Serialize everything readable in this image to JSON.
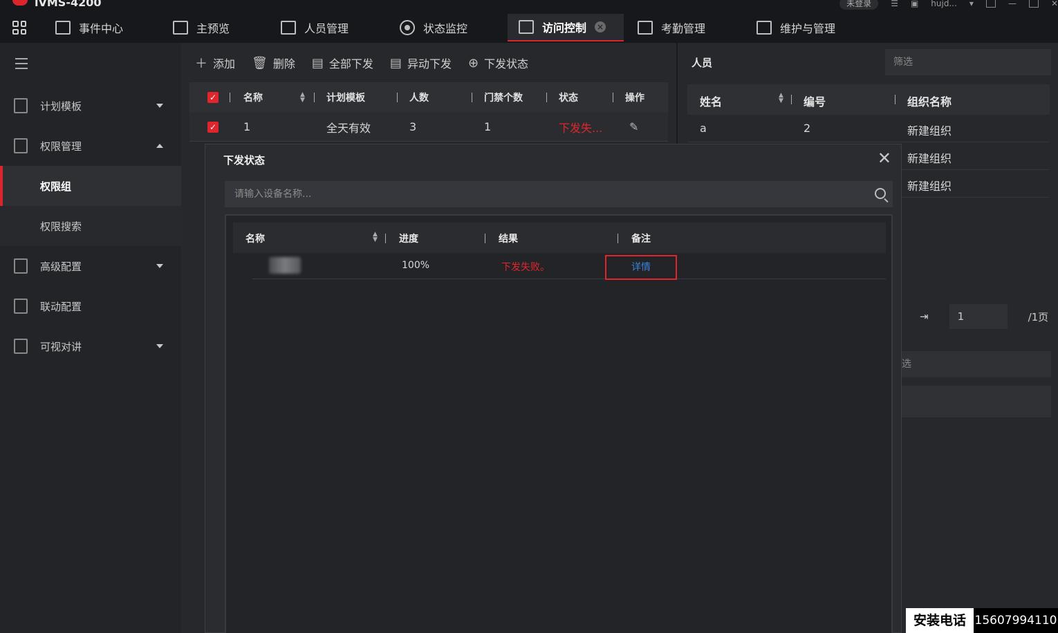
{
  "app": {
    "title": "iVMS-4200",
    "login_status": "未登录",
    "user": "hujd..."
  },
  "menu": [
    {
      "label": "事件中心"
    },
    {
      "label": "主预览"
    },
    {
      "label": "人员管理"
    },
    {
      "label": "状态监控"
    },
    {
      "label": "访问控制"
    },
    {
      "label": "考勤管理"
    },
    {
      "label": "维护与管理"
    }
  ],
  "sidebar": {
    "items": [
      {
        "label": "计划模板"
      },
      {
        "label": "权限管理"
      },
      {
        "label": "权限组"
      },
      {
        "label": "权限搜索"
      },
      {
        "label": "高级配置"
      },
      {
        "label": "联动配置"
      },
      {
        "label": "可视对讲"
      }
    ]
  },
  "toolbar": {
    "add": "添加",
    "delete": "删除",
    "apply_all": "全部下发",
    "apply_changes": "异动下发",
    "apply_status": "下发状态"
  },
  "group_table": {
    "headers": {
      "name": "名称",
      "template": "计划模板",
      "count": "人数",
      "doors": "门禁个数",
      "status": "状态",
      "ops": "操作"
    },
    "rows": [
      {
        "name": "1",
        "template": "全天有效",
        "count": "3",
        "doors": "1",
        "status": "下发失..."
      }
    ]
  },
  "person_panel": {
    "title": "人员",
    "filter_placeholder": "筛选",
    "headers": {
      "name": "姓名",
      "number": "编号",
      "org": "组织名称"
    },
    "rows": [
      {
        "name": "a",
        "number": "2",
        "org": "新建组织"
      },
      {
        "name": "",
        "number": "",
        "org": "新建组织"
      },
      {
        "name": "",
        "number": "",
        "org": "新建组织"
      }
    ],
    "page_value": "1",
    "page_total": "/1页",
    "lower_filter": "选"
  },
  "modal": {
    "title": "下发状态",
    "search_placeholder": "请输入设备名称...",
    "headers": {
      "name": "名称",
      "progress": "进度",
      "result": "结果",
      "note": "备注"
    },
    "rows": [
      {
        "progress": "100%",
        "result": "下发失败。",
        "note": "详情"
      }
    ]
  },
  "watermark": {
    "label": "安装电话",
    "phone": "15607994110"
  },
  "colors": {
    "accent": "#d8262c",
    "link": "#3b82d6",
    "background": "#1f2023"
  }
}
